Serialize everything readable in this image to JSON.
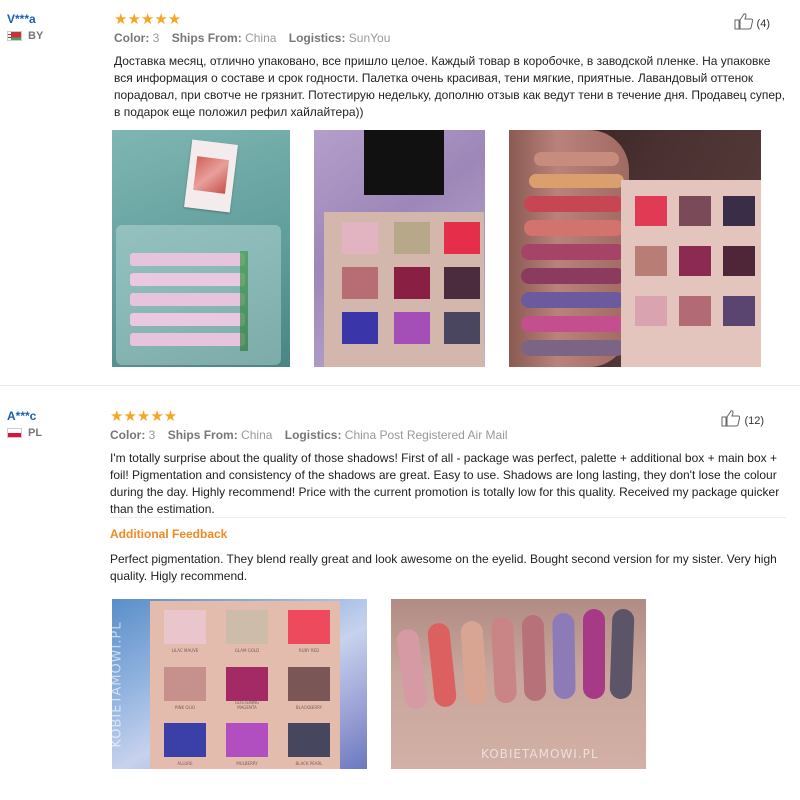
{
  "reviews": [
    {
      "user": "V***a",
      "country": "BY",
      "color_label": "Color:",
      "color_value": "3",
      "ships_label": "Ships From:",
      "ships_value": "China",
      "logistics_label": "Logistics:",
      "logistics_value": "SunYou",
      "helpful_count": "(4)",
      "rating": 5,
      "text": "Доставка месяц, отлично упаковано, все пришло целое. Каждый товар в коробочке, в заводской пленке. На упаковке вся информация о составе и срок годности. Палетка очень красивая, тени мягкие, приятные. Лавандовый оттенок порадовал, при свотче не грязнит. Потестирую недельку, дополню отзыв как ведут тени в течение дня. Продавец супер, в подарок еще положил рефил хайлайтера))"
    },
    {
      "user": "A***c",
      "country": "PL",
      "color_label": "Color:",
      "color_value": "3",
      "ships_label": "Ships From:",
      "ships_value": "China",
      "logistics_label": "Logistics:",
      "logistics_value": "China Post Registered Air Mail",
      "helpful_count": "(12)",
      "rating": 5,
      "text": "I'm totally surprise about the quality of those shadows! First of all - package was perfect, palette + additional box + main box + foil! Pigmentation and consistency of the shadows are great. Easy to use. Shadows are long lasting, they don't lose the colour during the day. Highly recommend! Price with the current promotion is totally low for this quality. Received my package quicker than the estimation.",
      "additional_title": "Additional Feedback",
      "additional_text": "Perfect pigmentation. They blend really great and look awesome on the eyelid. Bought second version for my sister. Very high quality. Higly recommend."
    }
  ],
  "stars_glyph": "★★★★★",
  "palette_labels": [
    "LILAC MAUVE",
    "GLAM GOLD",
    "RUBY RED",
    "PINK OLIO",
    "GLISTENING MAGENTA",
    "BLACKBERRY",
    "ALLURE",
    "MULBERRY",
    "BLACK PEARL"
  ],
  "watermark": "KOBIETAMOWI.PL",
  "colors": {
    "username": "#1a5fb4",
    "stars": "#f5a623",
    "additional_feedback": "#f08a24"
  }
}
